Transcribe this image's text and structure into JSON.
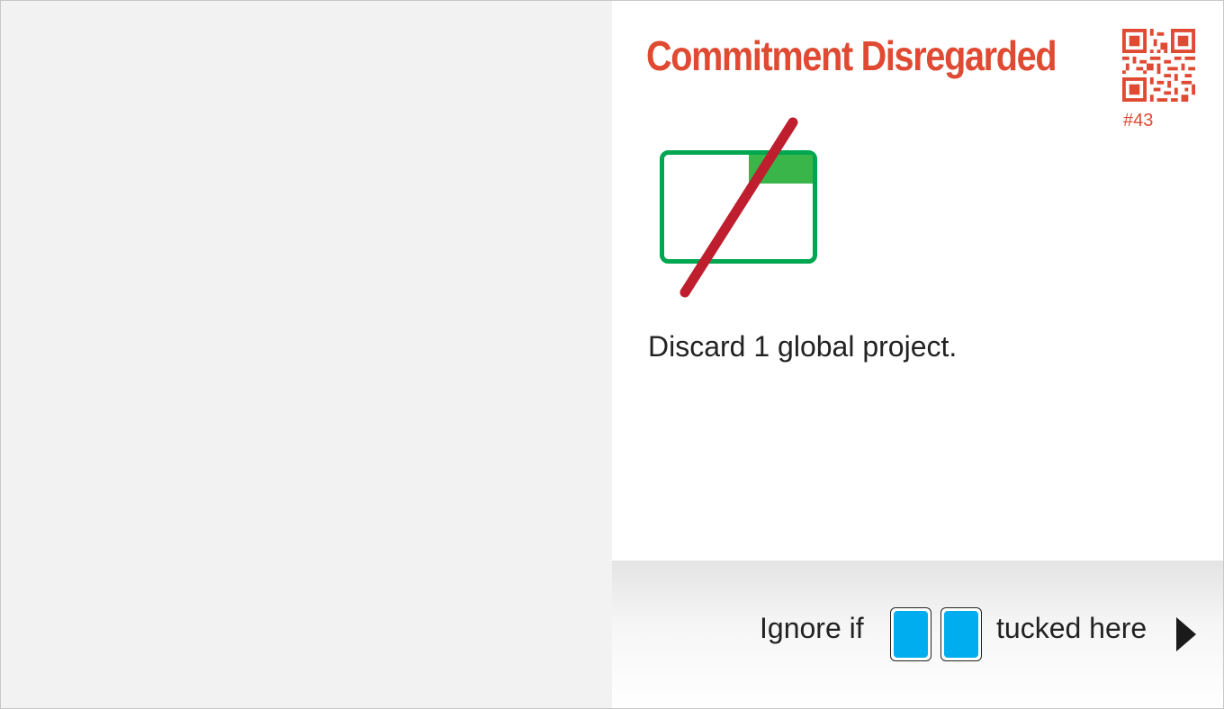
{
  "card": {
    "title": "Commitment Disregarded",
    "number": "#43",
    "description": "Discard 1 global project.",
    "icon": "global-project-crossed-out-icon",
    "qr_icon": "qr-code-icon"
  },
  "footer": {
    "prefix": "Ignore if",
    "suffix": "tucked here",
    "slot_icons": [
      "blue-card-icon",
      "blue-card-icon"
    ],
    "arrow_icon": "right-arrow-icon"
  },
  "colors": {
    "title": "#e04a33",
    "project_outline": "#00a650",
    "project_tab": "#39b54a",
    "strike": "#be1e2d",
    "slot_fill": "#00aeef",
    "left_panel": "#f2f2f2"
  }
}
